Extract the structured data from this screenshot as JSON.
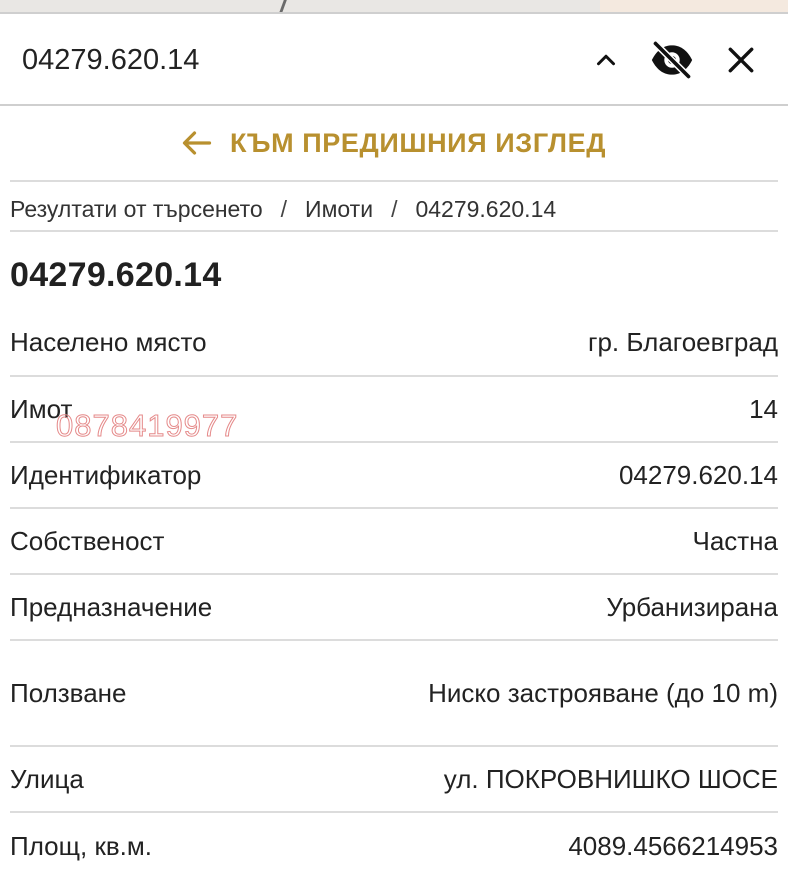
{
  "search": {
    "value": "04279.620.14"
  },
  "back": {
    "label": "КЪМ ПРЕДИШНИЯ ИЗГЛЕД"
  },
  "breadcrumb": {
    "items": [
      "Резултати от търсенето",
      "Имоти",
      "04279.620.14"
    ],
    "separator": "/"
  },
  "title": "04279.620.14",
  "watermark": "0878419977",
  "rows": [
    {
      "label": "Населено място",
      "value": "гр. Благоевград"
    },
    {
      "label": "Имот",
      "value": "14"
    },
    {
      "label": "Идентификатор",
      "value": "04279.620.14"
    },
    {
      "label": "Собственост",
      "value": "Частна"
    },
    {
      "label": "Предназначение",
      "value": "Урбанизирана"
    },
    {
      "label": "Ползване",
      "value": "Ниско застрояване (до 10 m)"
    },
    {
      "label": "Улица",
      "value": "ул. ПОКРОВНИШКО ШОСЕ"
    },
    {
      "label": "Площ, кв.м.",
      "value": "4089.4566214953"
    }
  ],
  "icons": {
    "collapse": "chevron-up-icon",
    "visibility": "eye-off-icon",
    "close": "close-icon",
    "back": "arrow-left-icon"
  },
  "colors": {
    "accent": "#b8902f",
    "text": "#212121",
    "divider": "#dcdcdc",
    "watermark": "#e58a8a"
  }
}
